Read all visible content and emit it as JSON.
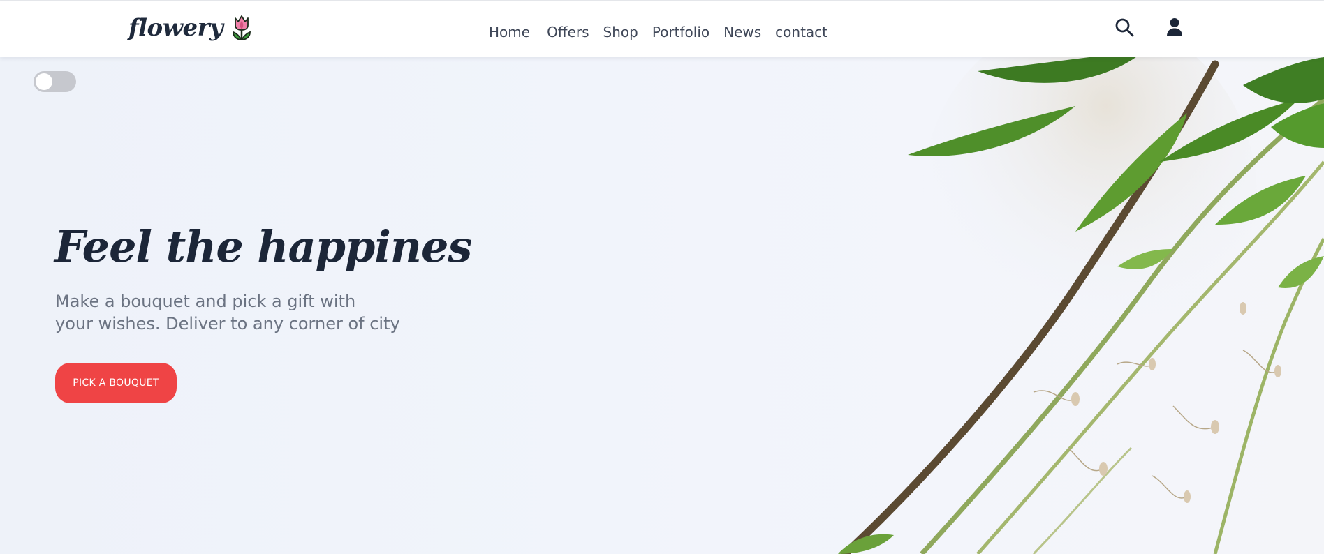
{
  "brand": {
    "name": "flowery",
    "logo_icon": "tulip-icon"
  },
  "nav": {
    "items": [
      {
        "label": "Home"
      },
      {
        "label": "Offers"
      },
      {
        "label": "Shop"
      },
      {
        "label": "Portfolio"
      },
      {
        "label": "News"
      },
      {
        "label": "contact"
      }
    ]
  },
  "header_icons": {
    "search": "search-icon",
    "user": "user-icon"
  },
  "theme_toggle": {
    "state": "off"
  },
  "hero": {
    "title": "Feel the happines",
    "subtitle_line1": "Make a bouquet and pick a gift with",
    "subtitle_line2": "your wishes. Deliver to any corner of city",
    "cta_label": "PICK A BOUQUET",
    "image": "green-plant-stems"
  },
  "colors": {
    "accent": "#ef4445",
    "text_dark": "#1c2638",
    "text_muted": "#6b7382",
    "hero_bg": "#eef2f9",
    "toggle_off": "#c6c8ce"
  }
}
